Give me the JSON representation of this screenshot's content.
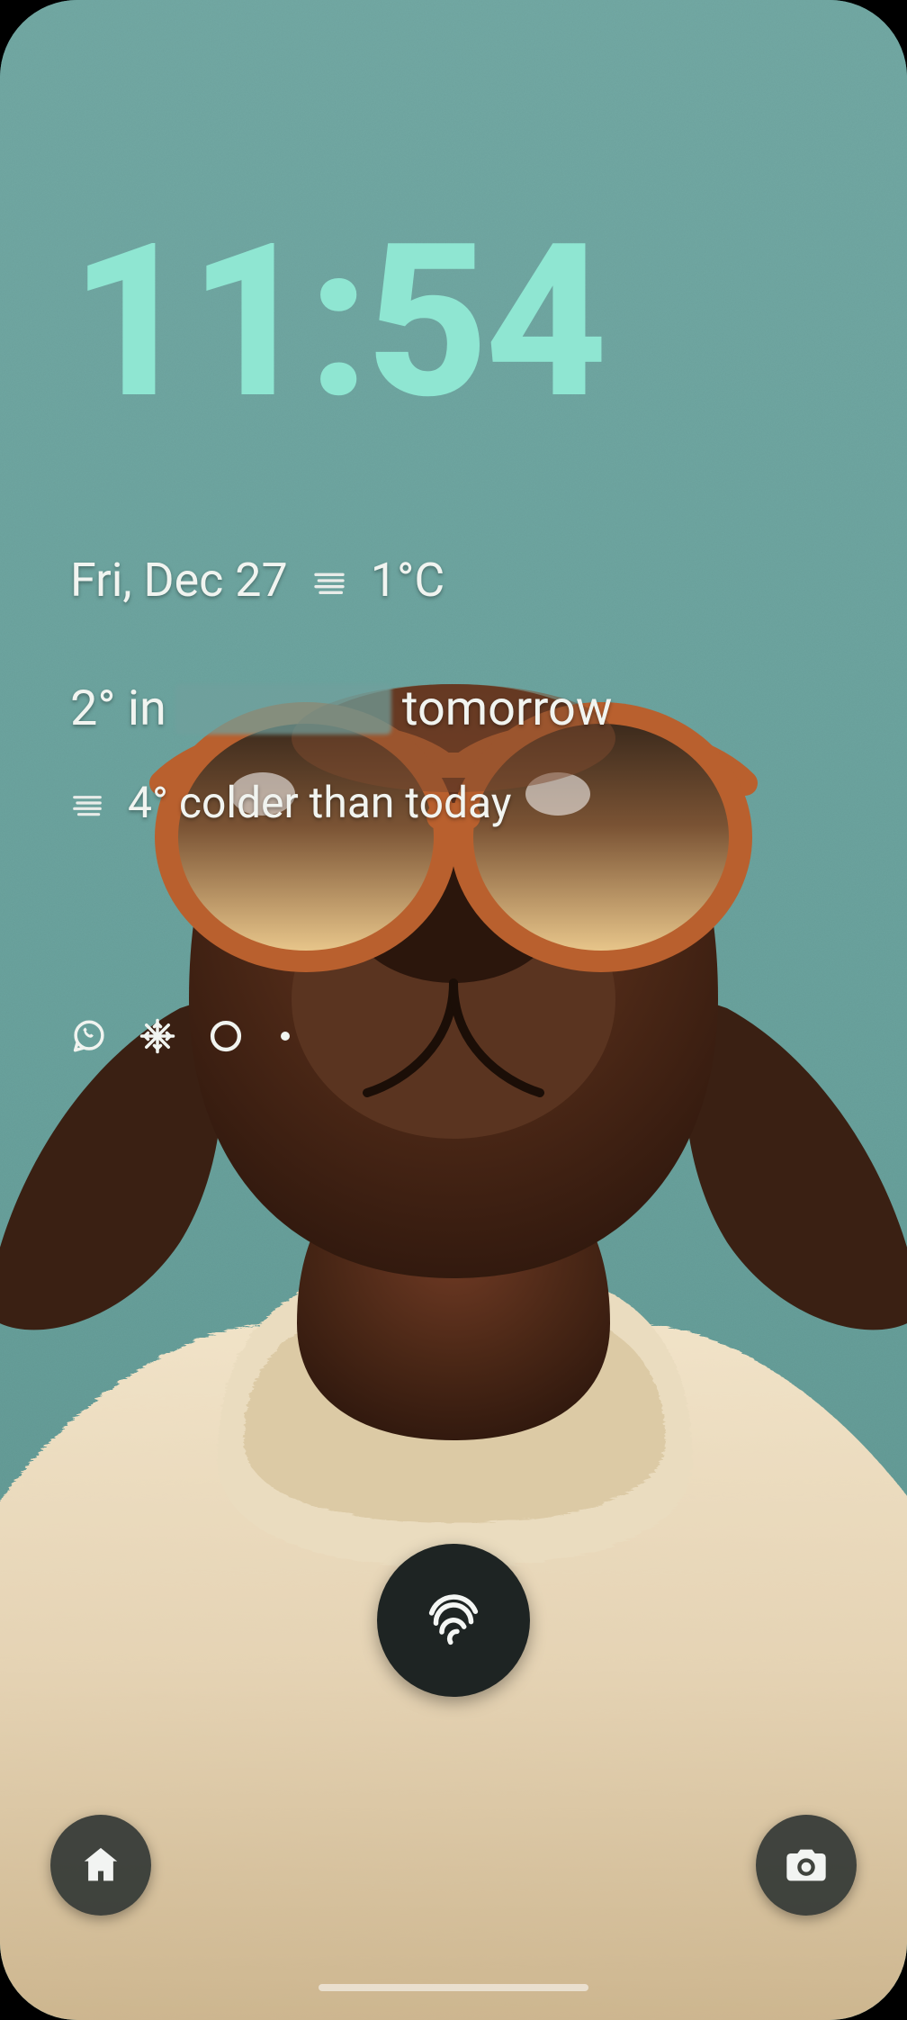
{
  "clock": {
    "time": "11:54"
  },
  "date_row": {
    "date": "Fri, Dec 27",
    "weather_icon": "fog-icon",
    "temp": "1°C"
  },
  "at_a_glance": {
    "line1_prefix": "2° in",
    "line1_suffix": "tomorrow",
    "line2_icon": "fog-icon",
    "line2_text": "4° colder than today"
  },
  "notifications": {
    "icons": [
      "whatsapp-icon",
      "snowflake-icon",
      "circle-outline-icon"
    ],
    "has_more": true
  },
  "unlock": {
    "method": "fingerprint"
  },
  "shortcuts": {
    "left": {
      "name": "home-devices-shortcut",
      "icon": "home-devices-icon"
    },
    "right": {
      "name": "camera-shortcut",
      "icon": "camera-icon"
    }
  },
  "wallpaper": {
    "description": "brown dog wearing orange sunglasses and cream turtleneck sweater on teal background"
  }
}
